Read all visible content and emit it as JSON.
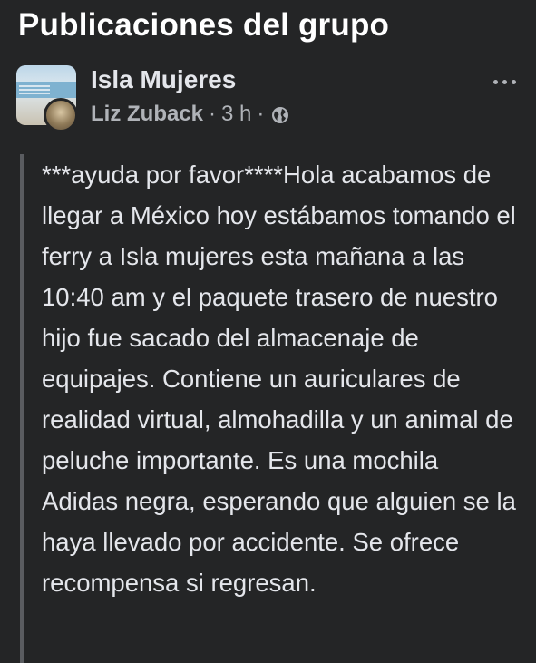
{
  "section": {
    "title": "Publicaciones del grupo"
  },
  "post": {
    "group_name": "Isla Mujeres",
    "author": "Liz Zuback",
    "separator": "·",
    "time": "3 h",
    "privacy_icon": "globe-icon",
    "more_icon": "more-options-icon",
    "text": "***ayuda por favor****Hola acabamos de llegar a México hoy estábamos tomando el ferry a Isla mujeres esta mañana a las 10:40 am y el paquete trasero de nuestro hijo fue sacado del almacenaje de equipajes. Contiene un auriculares de realidad virtual, almohadilla y un animal de peluche importante. Es una mochila Adidas negra, esperando que alguien se la haya llevado por accidente. Se ofrece recompensa si regresan."
  },
  "colors": {
    "background": "#242526",
    "primary_text": "#e4e6eb",
    "secondary_text": "#b0b3b8",
    "quote_bar": "#5a5c60"
  }
}
